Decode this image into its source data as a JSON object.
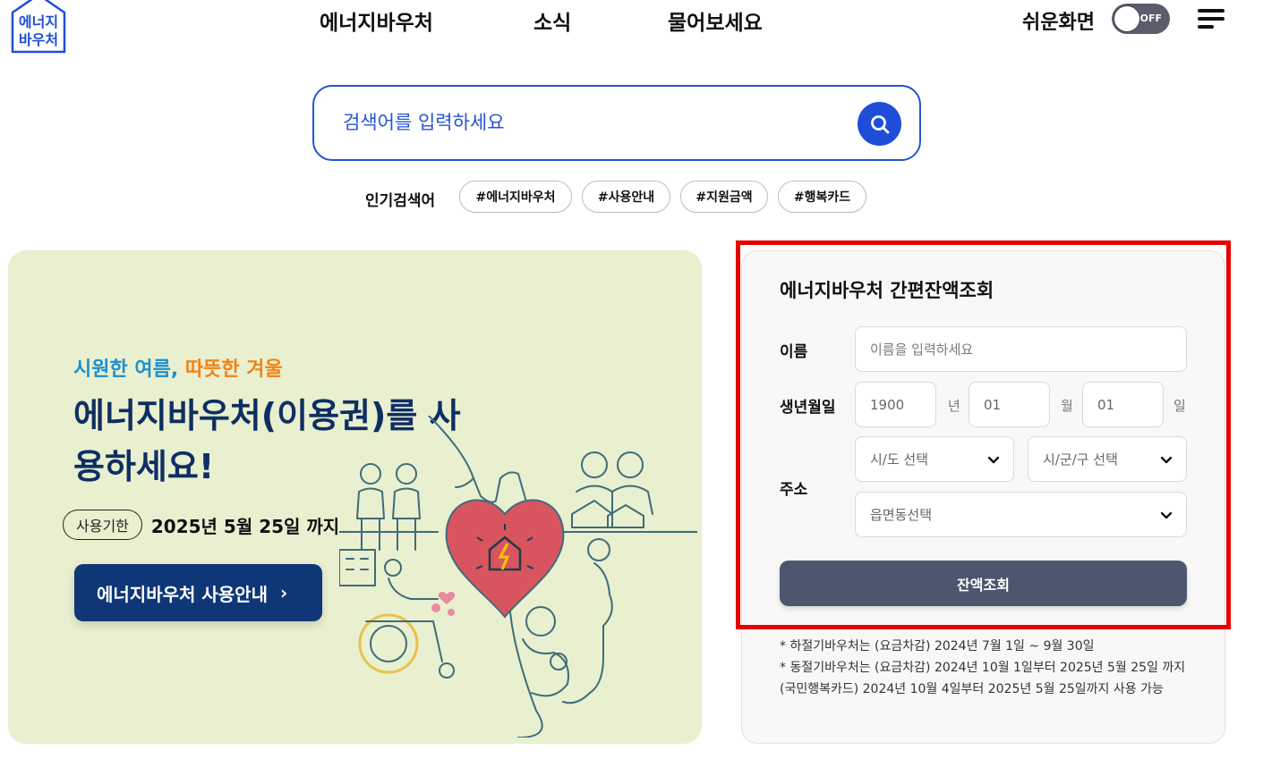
{
  "header": {
    "logo_line1": "에너지",
    "logo_line2": "바우처",
    "nav": [
      "에너지바우처",
      "소식",
      "물어보세요"
    ],
    "easy_view_label": "쉬운화면",
    "toggle_state": "OFF"
  },
  "search": {
    "placeholder": "검색어를 입력하세요",
    "popular_label": "인기검색어",
    "popular_keywords": [
      "#에너지바우처",
      "#사용안내",
      "#지원금액",
      "#행복카드"
    ]
  },
  "banner": {
    "tagline_part1": "시원한 여름,",
    "tagline_part2": "따뜻한 겨울",
    "headline": "에너지바우처(이용권)를 사용하세요!",
    "deadline_label": "사용기한",
    "deadline_date": "2025년 5월 25일 까지",
    "button_label": "에너지바우처 사용안내",
    "button_arrow": "›"
  },
  "balance": {
    "title": "에너지바우처 간편잔액조회",
    "name_label": "이름",
    "name_placeholder": "이름을 입력하세요",
    "birth_label": "생년월일",
    "year_value": "1900",
    "year_unit": "년",
    "month_value": "01",
    "month_unit": "월",
    "day_value": "01",
    "day_unit": "일",
    "address_label": "주소",
    "sido_select": "시/도 선택",
    "sigungu_select": "시/군/구 선택",
    "eupmyeondong_select": "읍면동선택",
    "submit_label": "잔액조회",
    "notes": [
      "* 하절기바우처는 (요금차감) 2024년 7월 1일 ~ 9월 30일",
      "* 동절기바우처는 (요금차감) 2024년 10월 1일부터 2025년 5월 25일 까지 (국민행복카드) 2024년 10월 4일부터 2025년 5월 25일까지 사용 가능"
    ]
  },
  "colors": {
    "primary_blue": "#1e4ed8",
    "banner_bg": "#e9f0cf",
    "banner_navy": "#0f3778",
    "submit_gray": "#4e566e",
    "highlight_red": "#e60000"
  }
}
